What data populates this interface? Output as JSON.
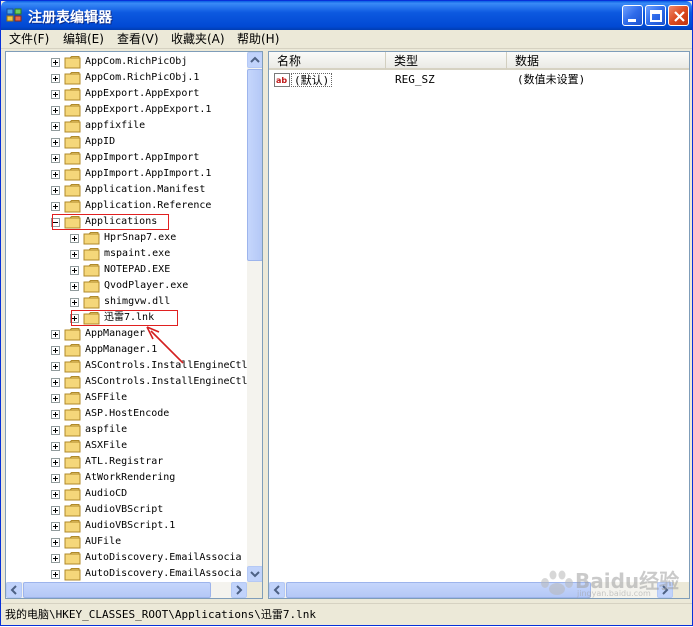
{
  "window": {
    "title": "注册表编辑器"
  },
  "menu": [
    {
      "label": "文件(F)"
    },
    {
      "label": "编辑(E)"
    },
    {
      "label": "查看(V)"
    },
    {
      "label": "收藏夹(A)"
    },
    {
      "label": "帮助(H)"
    }
  ],
  "tree": {
    "items": [
      {
        "label": "AppCom.RichPicObj",
        "level": 1,
        "expander": "plus"
      },
      {
        "label": "AppCom.RichPicObj.1",
        "level": 1,
        "expander": "plus"
      },
      {
        "label": "AppExport.AppExport",
        "level": 1,
        "expander": "plus"
      },
      {
        "label": "AppExport.AppExport.1",
        "level": 1,
        "expander": "plus"
      },
      {
        "label": "appfixfile",
        "level": 1,
        "expander": "plus"
      },
      {
        "label": "AppID",
        "level": 1,
        "expander": "plus"
      },
      {
        "label": "AppImport.AppImport",
        "level": 1,
        "expander": "plus"
      },
      {
        "label": "AppImport.AppImport.1",
        "level": 1,
        "expander": "plus"
      },
      {
        "label": "Application.Manifest",
        "level": 1,
        "expander": "plus"
      },
      {
        "label": "Application.Reference",
        "level": 1,
        "expander": "plus"
      },
      {
        "label": "Applications",
        "level": 1,
        "expander": "minus",
        "highlight": true
      },
      {
        "label": "HprSnap7.exe",
        "level": 2,
        "expander": "plus"
      },
      {
        "label": "mspaint.exe",
        "level": 2,
        "expander": "plus"
      },
      {
        "label": "NOTEPAD.EXE",
        "level": 2,
        "expander": "plus"
      },
      {
        "label": "QvodPlayer.exe",
        "level": 2,
        "expander": "plus"
      },
      {
        "label": "shimgvw.dll",
        "level": 2,
        "expander": "plus"
      },
      {
        "label": "迅雷7.lnk",
        "level": 2,
        "expander": "plus",
        "highlight": true,
        "selected": true
      },
      {
        "label": "AppManager",
        "level": 1,
        "expander": "plus"
      },
      {
        "label": "AppManager.1",
        "level": 1,
        "expander": "plus"
      },
      {
        "label": "ASControls.InstallEngineCtl",
        "level": 1,
        "expander": "plus"
      },
      {
        "label": "ASControls.InstallEngineCtl.",
        "level": 1,
        "expander": "plus"
      },
      {
        "label": "ASFFile",
        "level": 1,
        "expander": "plus"
      },
      {
        "label": "ASP.HostEncode",
        "level": 1,
        "expander": "plus"
      },
      {
        "label": "aspfile",
        "level": 1,
        "expander": "plus"
      },
      {
        "label": "ASXFile",
        "level": 1,
        "expander": "plus"
      },
      {
        "label": "ATL.Registrar",
        "level": 1,
        "expander": "plus"
      },
      {
        "label": "AtWorkRendering",
        "level": 1,
        "expander": "plus"
      },
      {
        "label": "AudioCD",
        "level": 1,
        "expander": "plus"
      },
      {
        "label": "AudioVBScript",
        "level": 1,
        "expander": "plus"
      },
      {
        "label": "AudioVBScript.1",
        "level": 1,
        "expander": "plus"
      },
      {
        "label": "AUFile",
        "level": 1,
        "expander": "plus"
      },
      {
        "label": "AutoDiscovery.EmailAssocia",
        "level": 1,
        "expander": "plus"
      },
      {
        "label": "AutoDiscovery.EmailAssocia",
        "level": 1,
        "expander": "plus"
      }
    ]
  },
  "list": {
    "columns": [
      "名称",
      "类型",
      "数据"
    ],
    "rows": [
      {
        "name": "(默认)",
        "type": "REG_SZ",
        "data": "(数值未设置)"
      }
    ]
  },
  "status": {
    "path": "我的电脑\\HKEY_CLASSES_ROOT\\Applications\\迅雷7.lnk"
  },
  "watermark": {
    "text": "Baidu经验",
    "sub": "jingyan.baidu.com"
  },
  "colors": {
    "titlebar": "#0149d3",
    "highlight_box": "#e02020",
    "folder": "#f5d77a"
  }
}
